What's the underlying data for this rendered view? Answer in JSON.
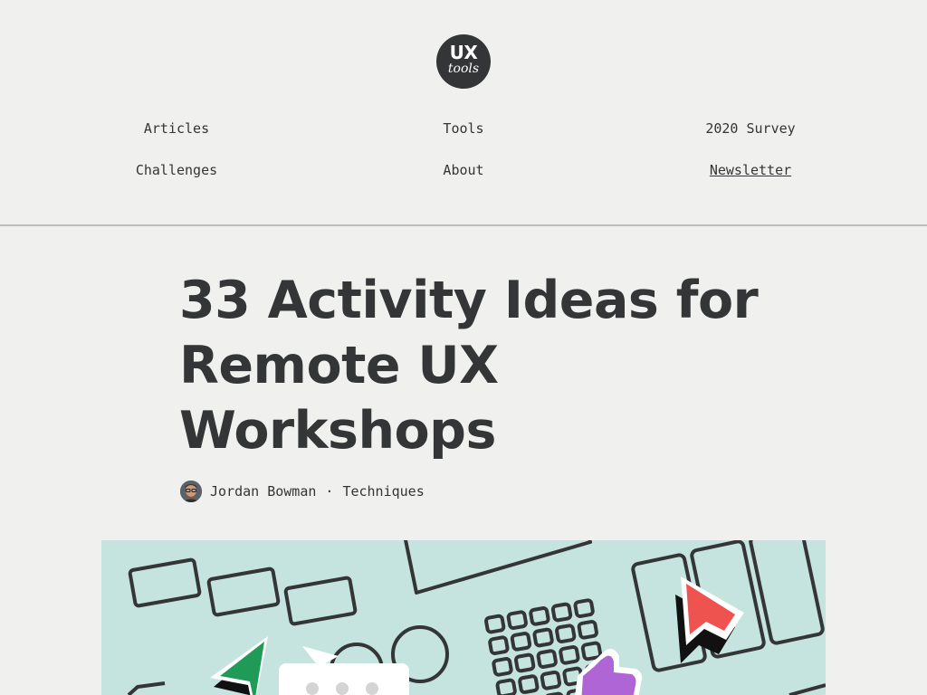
{
  "logo": {
    "line1": "UX",
    "line2": "tools"
  },
  "nav": {
    "articles": "Articles",
    "tools": "Tools",
    "survey": "2020 Survey",
    "challenges": "Challenges",
    "about": "About",
    "newsletter": "Newsletter"
  },
  "article": {
    "title": "33 Activity Ideas for Remote UX Workshops",
    "author": "Jordan Bowman",
    "separator": "·",
    "category": "Techniques"
  },
  "colors": {
    "background": "#f0f0ee",
    "text": "#333536",
    "hero_background": "#c5e3df",
    "cursor_green": "#1f9a57",
    "cursor_red": "#ef5350",
    "thumb_purple": "#b065d6"
  },
  "icons": {
    "hero_cursors": [
      "green-cursor-icon",
      "red-cursor-icon",
      "thumbs-up-icon",
      "speech-bubble-icon"
    ]
  }
}
